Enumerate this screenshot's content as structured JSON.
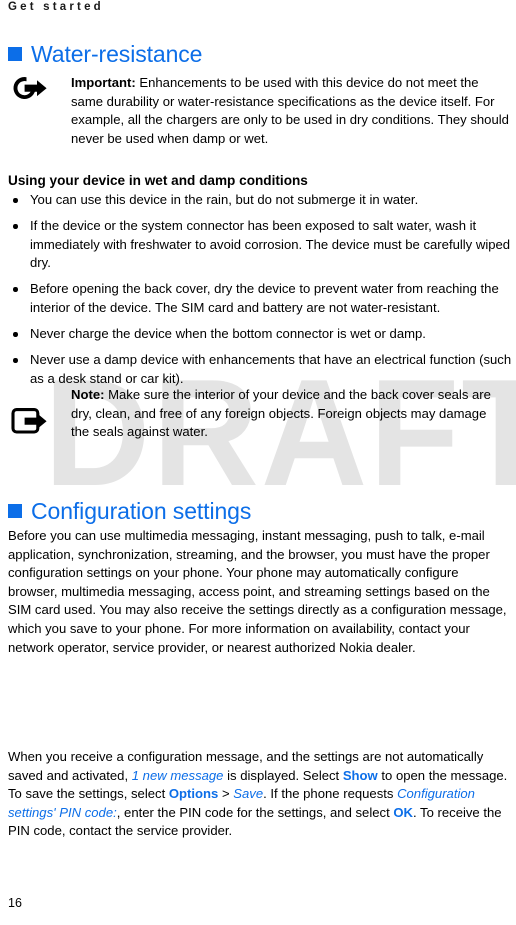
{
  "header": {
    "running_title": "Get started"
  },
  "watermark": {
    "text": "DRAFT",
    "color": "#e4e4e4"
  },
  "accent_color": "#0c6ee8",
  "sections": {
    "water_resistance": {
      "heading": "Water-resistance",
      "important": {
        "icon": "important-arrow-icon",
        "label": "Important:",
        "body": " Enhancements to be used with this device do not meet the same durability or water-resistance specifications as the device itself. For example, all the chargers are only to be used in dry conditions. They should never be used when damp or wet."
      },
      "subheading": "Using your device in wet and damp conditions",
      "bullets": [
        "You can use this device in the rain, but do not submerge it in water.",
        "If the device or the system connector has been exposed to salt water, wash it immediately with freshwater to avoid corrosion. The device must be carefully wiped dry.",
        "Before opening the back cover, dry the device to prevent water from reaching the interior of the device. The SIM card and battery are not water-resistant.",
        "Never charge the device when the bottom connector is wet or damp.",
        "Never use a damp device with enhancements that have an electrical function (such as a desk stand or car kit)."
      ],
      "note": {
        "icon": "note-arrow-icon",
        "label": "Note:",
        "body": " Make sure the interior of your device and the back cover seals are dry, clean, and free of any foreign objects. Foreign objects may damage the seals against water."
      }
    },
    "configuration_settings": {
      "heading": "Configuration settings",
      "paragraph_intro": "Before you can use multimedia messaging, instant messaging, push to talk, e-mail application, synchronization, streaming, and the browser, you must have the proper configuration settings on your phone. Your phone may automatically configure browser, multimedia messaging, access point, and streaming settings based on the SIM card used. You may also receive the settings directly as a configuration message, which you save to your phone. For more information on availability, contact your network operator, service provider, or nearest authorized Nokia dealer.",
      "paragraph_message": {
        "part1": "When you receive a configuration message, and the settings are not automatically saved and activated, ",
        "ui_new_message": "1 new message",
        "part2": " is displayed. Select ",
        "ui_show": "Show",
        "part3": " to open the message. To save the settings, select ",
        "ui_options": "Options",
        "part4": " > ",
        "ui_save": "Save",
        "part5": ". If the phone requests ",
        "ui_pin_prompt": "Configuration settings' PIN code:",
        "part6": ", enter the PIN code for the settings, and select ",
        "ui_ok": "OK",
        "part7": ". To receive the PIN code, contact the service provider."
      }
    }
  },
  "footer": {
    "page_number": "16"
  }
}
